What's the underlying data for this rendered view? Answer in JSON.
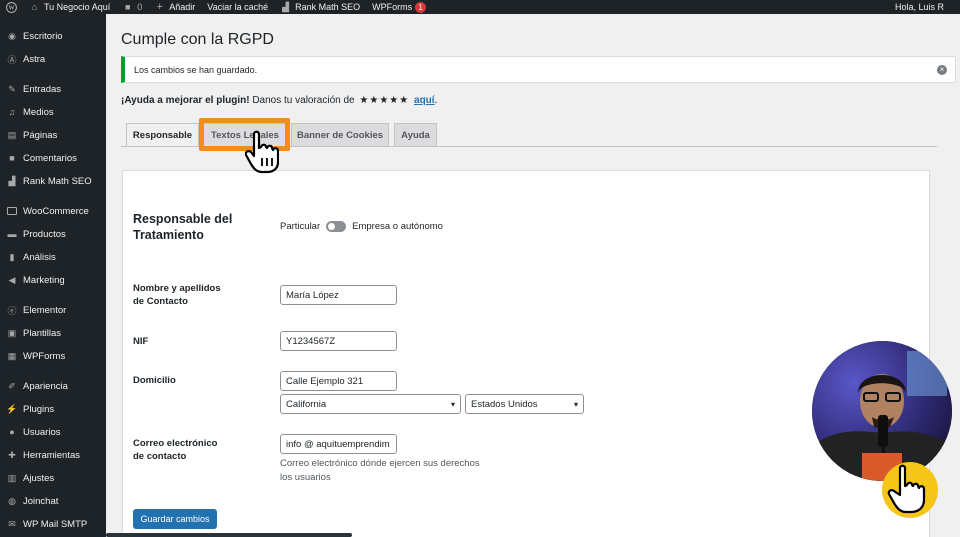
{
  "admin_bar": {
    "site_name": "Tu Negocio Aquí",
    "comments_count": "0",
    "add_new": "Añadir",
    "clear_cache": "Vaciar la caché",
    "rank_math": "Rank Math SEO",
    "wpforms": "WPForms",
    "wpforms_badge": "1",
    "greeting": "Hola, Luis R"
  },
  "sidebar": {
    "items": [
      {
        "label": "Escritorio",
        "icon": "dashboard-icon"
      },
      {
        "label": "Astra",
        "icon": "astra-icon"
      },
      {
        "label": "Entradas",
        "icon": "pin-icon"
      },
      {
        "label": "Medios",
        "icon": "media-icon"
      },
      {
        "label": "Páginas",
        "icon": "pages-icon"
      },
      {
        "label": "Comentarios",
        "icon": "comments-icon"
      },
      {
        "label": "Rank Math SEO",
        "icon": "rank-math-icon"
      },
      {
        "label": "WooCommerce",
        "icon": "woocommerce-icon"
      },
      {
        "label": "Productos",
        "icon": "products-icon"
      },
      {
        "label": "Análisis",
        "icon": "analytics-icon"
      },
      {
        "label": "Marketing",
        "icon": "megaphone-icon"
      },
      {
        "label": "Elementor",
        "icon": "elementor-icon"
      },
      {
        "label": "Plantillas",
        "icon": "templates-icon"
      },
      {
        "label": "WPForms",
        "icon": "wpforms-icon"
      },
      {
        "label": "Apariencia",
        "icon": "appearance-icon"
      },
      {
        "label": "Plugins",
        "icon": "plugins-icon"
      },
      {
        "label": "Usuarios",
        "icon": "users-icon"
      },
      {
        "label": "Herramientas",
        "icon": "tools-icon"
      },
      {
        "label": "Ajustes",
        "icon": "settings-icon"
      },
      {
        "label": "Joinchat",
        "icon": "joinchat-icon"
      },
      {
        "label": "WP Mail SMTP",
        "icon": "mail-icon"
      }
    ]
  },
  "page": {
    "title": "Cumple con la RGPD",
    "notice": "Los cambios se han guardado.",
    "help_bold": "¡Ayuda a mejorar el plugin!",
    "help_text": "Danos tu valoración de",
    "help_stars": "★★★★★",
    "help_link": "aquí",
    "help_end": "."
  },
  "tabs": [
    {
      "label": "Responsable",
      "active": true
    },
    {
      "label": "Textos Legales",
      "active": false
    },
    {
      "label": "Banner de Cookies",
      "active": false
    },
    {
      "label": "Ayuda",
      "active": false
    }
  ],
  "form": {
    "section_title_1": "Responsable del",
    "section_title_2": "Tratamiento",
    "toggle_left": "Particular",
    "toggle_right": "Empresa o autónomo",
    "name_label_1": "Nombre y apellidos",
    "name_label_2": "de Contacto",
    "name_value": "María López",
    "nif_label": "NIF",
    "nif_value": "Y1234567Z",
    "address_label": "Domicilio",
    "address_value": "Calle Ejemplo 321",
    "state_value": "California",
    "country_value": "Estados Unidos",
    "email_label_1": "Correo electrónico",
    "email_label_2": "de contacto",
    "email_value": "info @ aquituemprendim",
    "email_desc": "Correo electrónico dónde ejercen sus derechos los usuarios",
    "save_button": "Guardar cambios"
  },
  "colors": {
    "admin_dark": "#1d2327",
    "primary_blue": "#2271b1",
    "success_green": "#00a32a",
    "highlight_orange": "#f28c1a"
  }
}
